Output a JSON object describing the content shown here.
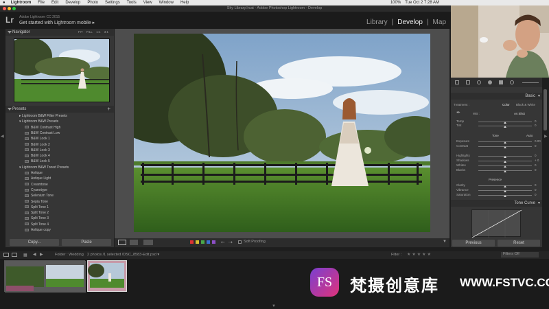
{
  "menubar": {
    "apple": "",
    "items": [
      "Lightroom",
      "File",
      "Edit",
      "Develop",
      "Photo",
      "Settings",
      "Tools",
      "View",
      "Window",
      "Help"
    ],
    "clock": "Tue Oct 2  7:28 AM",
    "battery": "100%"
  },
  "window": {
    "title": "Sky Library.lrcat - Adobe Photoshop Lightroom - Develop"
  },
  "identity": {
    "logo": "Lr",
    "product": "Adobe Lightroom CC 2015",
    "promo": "Get started with Lightroom mobile  ▸"
  },
  "modules": {
    "library": "Library",
    "separator": "|",
    "develop": "Develop",
    "map": "Map"
  },
  "left_panel": {
    "navigator": {
      "title": "Navigator",
      "zoom": "FIT",
      "zoom_fill": "FILL",
      "zoom_1": "1:1",
      "zoom_3": "3:1"
    },
    "presets": {
      "title": "Presets",
      "add": "+",
      "folders": [
        {
          "name": "Lightroom B&W Filter Presets",
          "expanded": false
        },
        {
          "name": "Lightroom B&W Presets",
          "expanded": true,
          "items": [
            "B&W Contrast High",
            "B&W Contrast Low",
            "B&W Look 1",
            "B&W Look 2",
            "B&W Look 3",
            "B&W Look 4",
            "B&W Look 5"
          ]
        },
        {
          "name": "Lightroom B&W Toned Presets",
          "expanded": true,
          "items": [
            "Antique",
            "Antique Light",
            "Creamtone",
            "Cyanotype",
            "Selenium Tone",
            "Sepia Tone",
            "Split Tone 1",
            "Split Tone 2",
            "Split Tone 3",
            "Split Tone 4",
            "Antique copy"
          ]
        }
      ]
    },
    "copy_button": "Copy...",
    "paste_button": "Paste"
  },
  "toolbar": {
    "soft_proofing": "Soft Proofing"
  },
  "right_panel": {
    "basic": {
      "title": "Basic",
      "treatment_label": "Treatment :",
      "color": "Color",
      "bw": "Black & White",
      "wb_label": "WB :",
      "wb_value": "As Shot",
      "temp": "Temp",
      "tint": "Tint",
      "tone_label": "Tone",
      "auto": "Auto",
      "exposure": "Exposure",
      "contrast": "Contrast",
      "highlights": "Highlights",
      "shadows": "Shadows",
      "whites": "Whites",
      "blacks": "Blacks",
      "presence_label": "Presence",
      "clarity": "Clarity",
      "vibrance": "Vibrance",
      "saturation": "Saturation",
      "values": {
        "temp": "0",
        "tint": "0",
        "exposure": "0.00",
        "contrast": "0",
        "highlights": "0",
        "shadows": "+ 0",
        "whites": "0",
        "blacks": "0",
        "clarity": "0",
        "vibrance": "0",
        "saturation": "0"
      }
    },
    "tone_curve": {
      "title": "Tone Curve"
    },
    "previous_button": "Previous",
    "reset_button": "Reset"
  },
  "filmstrip": {
    "source_label": "Folder : Wedding",
    "selection_info": "2 photos /1 selected /DSC_8583-Edit.psd ▾",
    "filter_label": "Filter :",
    "filter_value": "Filters Off"
  },
  "watermark": {
    "logo": "FS",
    "text": "梵摄创意库",
    "url": "WWW.FSTVC.CC"
  },
  "colors": {
    "panel_bg": "#363636",
    "canvas_bg": "#4d4d4d",
    "brand_pink": "#e0337a",
    "brand_purple": "#7a3fd0"
  }
}
